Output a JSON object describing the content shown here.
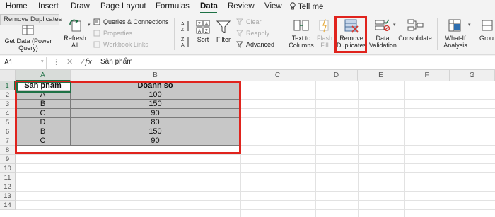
{
  "menu": {
    "tabs": [
      "Home",
      "Insert",
      "Draw",
      "Page Layout",
      "Formulas",
      "Data",
      "Review",
      "View",
      "Tell me"
    ],
    "active": "Data"
  },
  "tooltip": "Remove Duplicates",
  "ribbon": {
    "get_data_line1": "Get Data (Power",
    "get_data_line2": "Query)",
    "refresh_line1": "Refresh",
    "refresh_line2": "All",
    "queries": "Queries & Connections",
    "properties": "Properties",
    "workbook_links": "Workbook Links",
    "sort": "Sort",
    "filter": "Filter",
    "clear": "Clear",
    "reapply": "Reapply",
    "advanced": "Advanced",
    "text_to_columns_line1": "Text to",
    "text_to_columns_line2": "Columns",
    "flash_fill_line1": "Flash",
    "flash_fill_line2": "Fill",
    "remove_duplicates_line1": "Remove",
    "remove_duplicates_line2": "Duplicates",
    "data_validation_line1": "Data",
    "data_validation_line2": "Validation",
    "consolidate": "Consolidate",
    "what_if_line1": "What-If",
    "what_if_line2": "Analysis",
    "group": "Grou"
  },
  "formula_bar": {
    "name_box": "A1",
    "fx": "fx",
    "value": "Sản phẩm"
  },
  "grid": {
    "columns": [
      "A",
      "B",
      "C",
      "D",
      "E",
      "F",
      "G"
    ],
    "rows": [
      "1",
      "2",
      "3",
      "4",
      "5",
      "6",
      "7",
      "8",
      "9",
      "10",
      "11",
      "12",
      "13",
      "14"
    ],
    "table": {
      "headers": [
        "Sản phẩm",
        "Doanh số"
      ],
      "rows": [
        [
          "A",
          "100"
        ],
        [
          "B",
          "150"
        ],
        [
          "C",
          "90"
        ],
        [
          "D",
          "80"
        ],
        [
          "B",
          "150"
        ],
        [
          "C",
          "90"
        ]
      ]
    }
  },
  "colors": {
    "accent_green": "#1e7145",
    "highlight_red": "#e0231d",
    "table_fill": "#c7c7c7"
  }
}
